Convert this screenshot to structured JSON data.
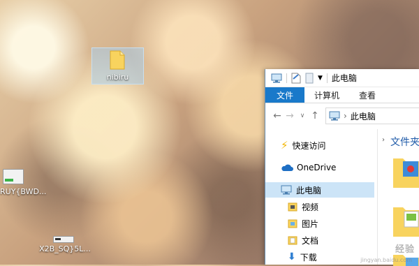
{
  "desktop": {
    "icons": [
      {
        "label": "nibiru"
      },
      {
        "label": "RUY{BWD..."
      },
      {
        "label": "X2B_SQ}5L..."
      }
    ]
  },
  "window": {
    "title": "此电脑",
    "ribbon_tabs": [
      "文件",
      "计算机",
      "查看"
    ],
    "address": "此电脑",
    "nav_items": [
      "快速访问",
      "OneDrive",
      "此电脑",
      "视频",
      "图片",
      "文档",
      "下载"
    ],
    "content_header": "文件夹"
  },
  "colors": {
    "accent": "#1979ca",
    "selected_bg": "#cce4f7",
    "folder": "#f8d35e"
  },
  "watermark": {
    "text": "经验",
    "sub": "jingyan.baidu.com"
  }
}
